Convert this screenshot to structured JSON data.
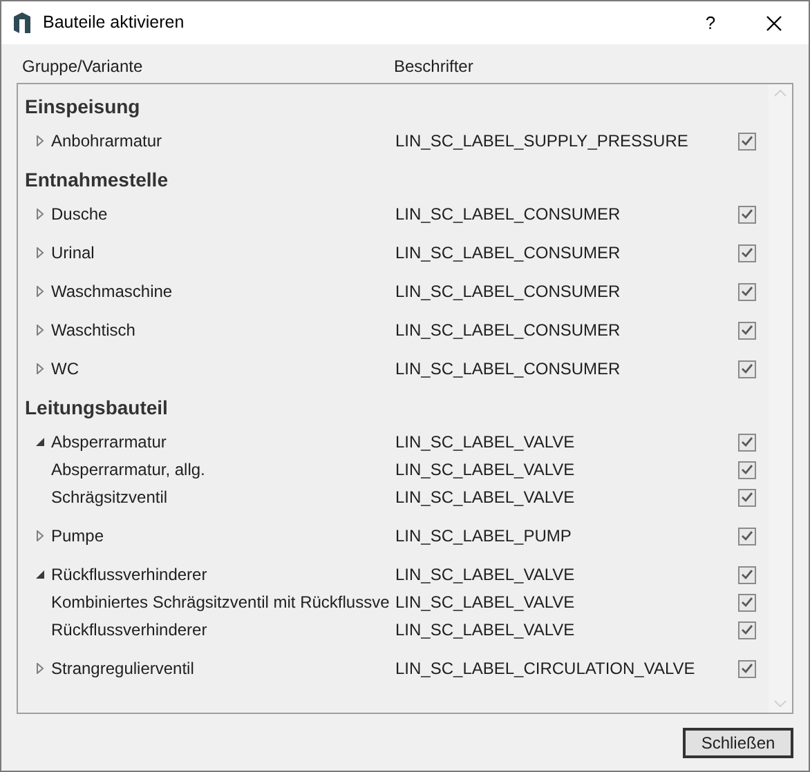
{
  "window": {
    "title": "Bauteile aktivieren",
    "help": "?"
  },
  "columns": [
    "Gruppe/Variante",
    "Beschrifter"
  ],
  "groups": [
    {
      "name": "Einspeisung",
      "items": [
        {
          "name": "Anbohrarmatur",
          "label": "LIN_SC_LABEL_SUPPLY_PRESSURE",
          "checked": true,
          "expanded": false
        }
      ]
    },
    {
      "name": "Entnahmestelle",
      "items": [
        {
          "name": "Dusche",
          "label": "LIN_SC_LABEL_CONSUMER",
          "checked": true,
          "expanded": false
        },
        {
          "name": "Urinal",
          "label": "LIN_SC_LABEL_CONSUMER",
          "checked": true,
          "expanded": false
        },
        {
          "name": "Waschmaschine",
          "label": "LIN_SC_LABEL_CONSUMER",
          "checked": true,
          "expanded": false
        },
        {
          "name": "Waschtisch",
          "label": "LIN_SC_LABEL_CONSUMER",
          "checked": true,
          "expanded": false
        },
        {
          "name": "WC",
          "label": "LIN_SC_LABEL_CONSUMER",
          "checked": true,
          "expanded": false
        }
      ]
    },
    {
      "name": "Leitungsbauteil",
      "items": [
        {
          "name": "Absperrarmatur",
          "label": "LIN_SC_LABEL_VALVE",
          "checked": true,
          "expanded": true,
          "children": [
            {
              "name": "Absperrarmatur, allg.",
              "label": "LIN_SC_LABEL_VALVE",
              "checked": true
            },
            {
              "name": "Schrägsitzventil",
              "label": "LIN_SC_LABEL_VALVE",
              "checked": true
            }
          ]
        },
        {
          "name": "Pumpe",
          "label": "LIN_SC_LABEL_PUMP",
          "checked": true,
          "expanded": false
        },
        {
          "name": "Rückflussverhinderer",
          "label": "LIN_SC_LABEL_VALVE",
          "checked": true,
          "expanded": true,
          "children": [
            {
              "name": "Kombiniertes Schrägsitzventil mit Rückflussve",
              "label": "LIN_SC_LABEL_VALVE",
              "checked": true
            },
            {
              "name": "Rückflussverhinderer",
              "label": "LIN_SC_LABEL_VALVE",
              "checked": true
            }
          ]
        },
        {
          "name": "Strangregulierventil",
          "label": "LIN_SC_LABEL_CIRCULATION_VALVE",
          "checked": true,
          "expanded": false
        }
      ]
    }
  ],
  "close_button": "Schließen"
}
